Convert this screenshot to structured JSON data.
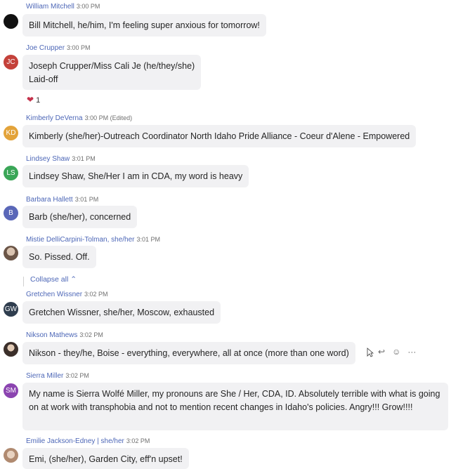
{
  "messages": [
    {
      "name": "William Mitchell",
      "time": "3:00 PM",
      "avatar": "",
      "avatar_color": "#111111",
      "text": "Bill Mitchell, he/him, I'm feeling super anxious for tomorrow!"
    },
    {
      "name": "Joe Crupper",
      "time": "3:00 PM",
      "avatar": "JC",
      "avatar_color": "#c4413a",
      "text": "Joseph Crupper/Miss Cali Je (he/they/she)",
      "text2": "Laid-off",
      "reaction": {
        "icon": "heart-icon",
        "count": "1"
      }
    },
    {
      "name": "Kimberly DeVerna",
      "time": "3:00 PM (Edited)",
      "avatar": "KD",
      "avatar_color": "#e3a33a",
      "text": "Kimberly (she/her)-Outreach Coordinator North Idaho Pride Alliance - Coeur d'Alene - Empowered"
    },
    {
      "name": "Lindsey Shaw",
      "time": "3:01 PM",
      "avatar": "LS",
      "avatar_color": "#3aa657",
      "text": "Lindsey Shaw, She/Her I am in CDA, my word is heavy"
    },
    {
      "name": "Barbara Hallett",
      "time": "3:01 PM",
      "avatar": "B",
      "avatar_color": "#5a67b8",
      "text": "Barb (she/her), concerned"
    },
    {
      "name": "Mistie DelliCarpini-Tolman, she/her",
      "time": "3:01 PM",
      "avatar": "",
      "avatar_color": "#8a6a55",
      "text": "So. Pissed. Off."
    },
    {
      "name": "Gretchen Wissner",
      "time": "3:02 PM",
      "avatar": "GW",
      "avatar_color": "#2f3d4e",
      "text": "Gretchen Wissner, she/her, Moscow, exhausted"
    },
    {
      "name": "Nikson Mathews",
      "time": "3:02 PM",
      "avatar": "",
      "avatar_color": "#3b2f2a",
      "text": "Nikson - they/he, Boise - everything, everywhere, all at once (more than one word)"
    },
    {
      "name": "Sierra Miller",
      "time": "3:02 PM",
      "avatar": "SM",
      "avatar_color": "#8b44b0",
      "text": "My name is Sierra Wolfé Miller, my pronouns are She / Her, CDA, ID. Absolutely terrible with what is going on at work with transphobia and not to mention recent changes in Idaho's policies. Angry!!! Grow!!!!"
    },
    {
      "name": "Emilie Jackson-Edney | she/her",
      "time": "3:02 PM",
      "avatar": "",
      "avatar_color": "#b08a70",
      "text": "Emi, (she/her), Garden City, eff'n upset!"
    }
  ],
  "collapse_label": "Collapse all ⌃",
  "actions": {
    "reply": "↩",
    "emoji": "☺",
    "more": "···"
  }
}
